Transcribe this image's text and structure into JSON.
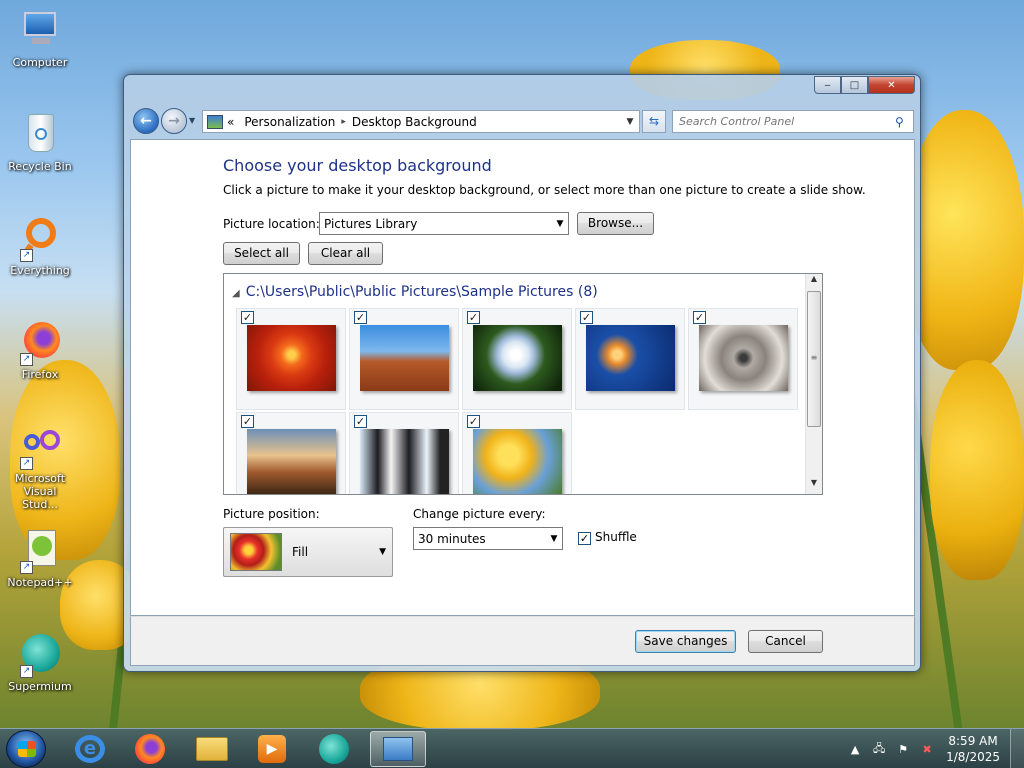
{
  "desktop": {
    "icons": [
      {
        "label": "Computer",
        "icon": "computer-icon"
      },
      {
        "label": "Recycle Bin",
        "icon": "recycle-bin-icon"
      },
      {
        "label": "Everything",
        "icon": "everything-icon"
      },
      {
        "label": "Firefox",
        "icon": "firefox-icon"
      },
      {
        "label": "Microsoft Visual Stud...",
        "icon": "visual-studio-icon"
      },
      {
        "label": "Notepad++",
        "icon": "notepad-plus-plus-icon"
      },
      {
        "label": "Supermium",
        "icon": "supermium-icon"
      }
    ]
  },
  "window": {
    "caption": {
      "minimize": "‒",
      "maximize": "□",
      "close": "✕"
    },
    "address": {
      "prefix": "«",
      "crumbs": [
        "Personalization",
        "Desktop Background"
      ],
      "separator": "▸"
    },
    "search": {
      "placeholder": "Search Control Panel"
    },
    "title": "Choose your desktop background",
    "description": "Click a picture to make it your desktop background, or select more than one picture to create a slide show.",
    "picture_location_label": "Picture location:",
    "picture_location_value": "Pictures Library",
    "browse_label": "Browse...",
    "select_all_label": "Select all",
    "clear_all_label": "Clear all",
    "group_header": "C:\\Users\\Public\\Public Pictures\\Sample Pictures (8)",
    "pictures": [
      {
        "name": "Chrysanthemum",
        "checked": true
      },
      {
        "name": "Desert",
        "checked": true
      },
      {
        "name": "Hydrangeas",
        "checked": true
      },
      {
        "name": "Jellyfish",
        "checked": true
      },
      {
        "name": "Koala",
        "checked": true
      },
      {
        "name": "Lighthouse",
        "checked": true
      },
      {
        "name": "Penguins",
        "checked": true
      },
      {
        "name": "Tulips",
        "checked": true
      }
    ],
    "picture_position_label": "Picture position:",
    "picture_position_value": "Fill",
    "change_every_label": "Change picture every:",
    "change_every_value": "30 minutes",
    "shuffle_label": "Shuffle",
    "shuffle_checked": true,
    "save_label": "Save changes",
    "cancel_label": "Cancel"
  },
  "taskbar": {
    "apps": [
      "Internet Explorer",
      "Firefox",
      "Windows Explorer",
      "Windows Media Player",
      "Supermium",
      "Control Panel"
    ],
    "active_app": "Control Panel",
    "tray": {
      "time": "8:59 AM",
      "date": "1/8/2025"
    }
  },
  "colors": {
    "title_blue": "#1e3287",
    "close_red": "#c3442f",
    "taskbar": "#2e4a5a"
  }
}
